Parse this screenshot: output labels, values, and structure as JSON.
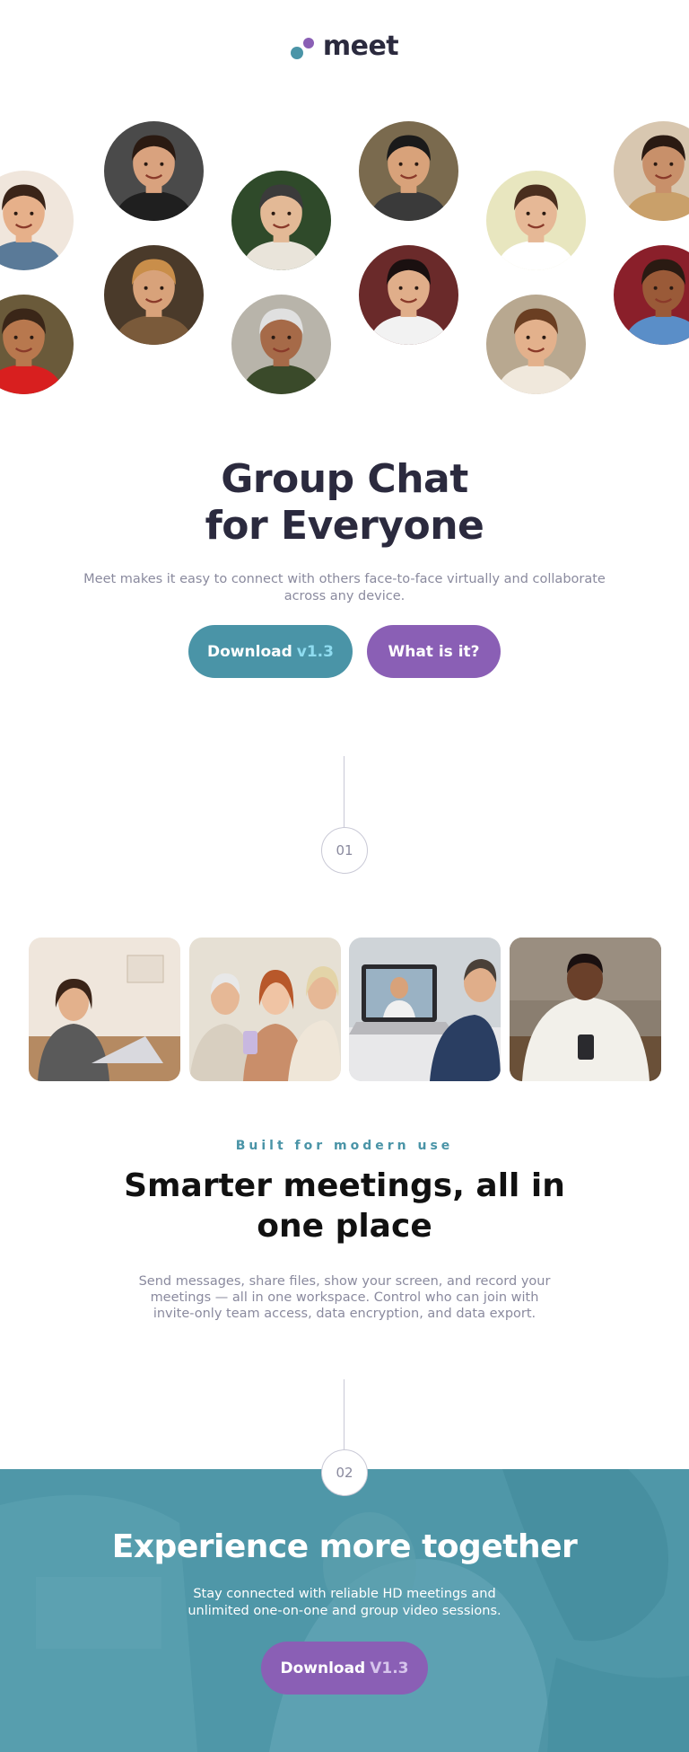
{
  "header": {
    "logo_text": "meet",
    "logo_colors": {
      "dot_primary": "#4a94a7",
      "dot_secondary": "#8a5fb5"
    }
  },
  "avatars": [
    {
      "name": "person-1",
      "bg": "#f0e6dc",
      "skin": "#e6b08a",
      "hair": "#3a2418",
      "shirt": "#5a7a98"
    },
    {
      "name": "person-2",
      "bg": "#4a4a4a",
      "skin": "#d9a27e",
      "hair": "#2a1a12",
      "shirt": "#1f1f1f"
    },
    {
      "name": "person-3",
      "bg": "#2f4a2a",
      "skin": "#e3b996",
      "hair": "#3b3b3b",
      "shirt": "#e9e4da"
    },
    {
      "name": "person-4",
      "bg": "#7a6a4e",
      "skin": "#d8a27a",
      "hair": "#1a1a1a",
      "shirt": "#3a3a3a"
    },
    {
      "name": "person-5",
      "bg": "#e8e6bf",
      "skin": "#e6b896",
      "hair": "#4a2e1e",
      "shirt": "#ffffff"
    },
    {
      "name": "person-6",
      "bg": "#d8c7b0",
      "skin": "#c8906a",
      "hair": "#2a1a12",
      "shirt": "#c9a06a"
    },
    {
      "name": "person-7",
      "bg": "#6a5a3a",
      "skin": "#b8784e",
      "hair": "#3a2618",
      "shirt": "#d81f1f"
    },
    {
      "name": "person-8",
      "bg": "#4a3a2a",
      "skin": "#d8a27a",
      "hair": "#c98e4a",
      "shirt": "#7a5a3a"
    },
    {
      "name": "person-9",
      "bg": "#b8b4aa",
      "skin": "#a66a48",
      "hair": "#e0e0e0",
      "shirt": "#3a4a2a"
    },
    {
      "name": "person-10",
      "bg": "#6a2a2a",
      "skin": "#e0ae8a",
      "hair": "#1a1010",
      "shirt": "#f2f2f2"
    },
    {
      "name": "person-11",
      "bg": "#b8a890",
      "skin": "#e3b18c",
      "hair": "#6a3e22",
      "shirt": "#f0e8dc"
    },
    {
      "name": "person-12",
      "bg": "#8a1f2a",
      "skin": "#9a5a38",
      "hair": "#2a1a12",
      "shirt": "#5a8ec8"
    }
  ],
  "hero": {
    "title_line1": "Group Chat",
    "title_line2": "for Everyone",
    "subtitle": "Meet makes it easy to connect with others face-to-face virtually and collaborate across any device.",
    "download_label": "Download",
    "download_version": "v1.3",
    "what_label": "What is it?"
  },
  "steps": [
    "01",
    "02"
  ],
  "photos": [
    {
      "name": "photo-woman-laptop",
      "bg": "#efe6dc"
    },
    {
      "name": "photo-women-phone",
      "bg": "#e6e0d4"
    },
    {
      "name": "photo-video-call",
      "bg": "#cfd4d8"
    },
    {
      "name": "photo-man-phone",
      "bg": "#8a7e70"
    }
  ],
  "features": {
    "eyebrow": "Built for modern use",
    "title_line1": "Smarter meetings, all in",
    "title_line2": "one place",
    "description": "Send messages, share files, show your screen, and record your meetings — all in one workspace. Control who can join with invite-only team access, data encryption, and data export."
  },
  "cta": {
    "title": "Experience more together",
    "subtitle": "Stay connected with reliable HD meetings and unlimited one-on-one and group video sessions.",
    "download_label": "Download",
    "download_version": "V1.3",
    "band_color": "#4f97a8"
  },
  "colors": {
    "teal": "#4a94a7",
    "purple": "#8a5fb5",
    "heading": "#2b2a3e",
    "muted": "#8a8a9e"
  }
}
